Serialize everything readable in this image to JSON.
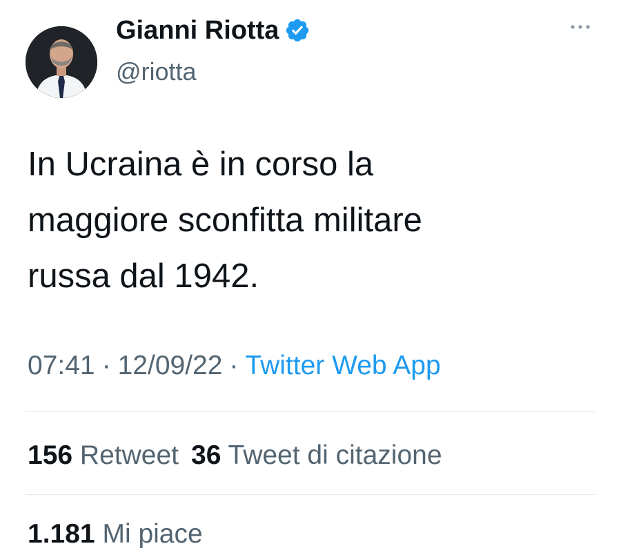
{
  "author": {
    "name": "Gianni Riotta",
    "handle": "@riotta",
    "verified": true
  },
  "icons": {
    "verified": "verified-badge-icon",
    "more": "more-options-icon"
  },
  "tweet": {
    "lines": [
      "In Ucraina è in corso la",
      "maggiore sconfitta militare",
      "russa dal 1942."
    ]
  },
  "meta": {
    "time": "07:41",
    "separator": "·",
    "date": "12/09/22",
    "source": "Twitter Web App"
  },
  "stats": {
    "retweets_count": "156",
    "retweets_label": "Retweet",
    "quotes_count": "36",
    "quotes_label": "Tweet di citazione",
    "likes_count": "1.181",
    "likes_label": "Mi piace"
  },
  "colors": {
    "text": "#0f1419",
    "secondary": "#536471",
    "link": "#1d9bf0",
    "verified": "#1d9bf0",
    "divider": "#e7e9ea"
  }
}
